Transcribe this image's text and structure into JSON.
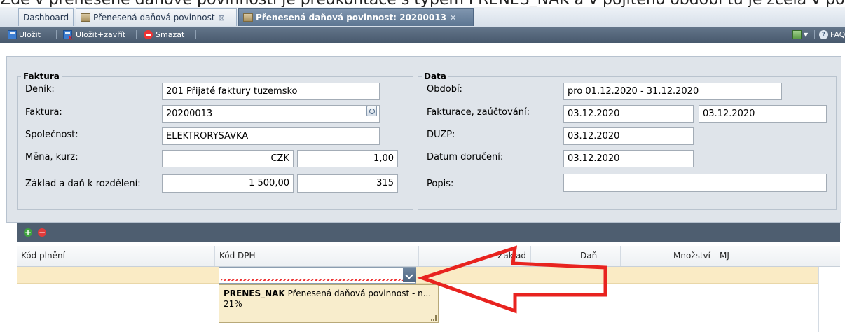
{
  "top_caption": "Zde v přenesené daňové povinnosti je předkontace s typem PRENES_NAK a v pojíteno období tu je zcela v pořádku",
  "tabs": [
    {
      "label": "Dashboard"
    },
    {
      "label": "Přenesená daňová povinnost"
    },
    {
      "label": "Přenesená daňová povinnost: 20200013"
    }
  ],
  "toolbar": {
    "save_label": "Uložit",
    "save_close_label": "Uložit+zavřít",
    "delete_label": "Smazat",
    "faq_label": "FAQ"
  },
  "faktura": {
    "legend": "Faktura",
    "denik_label": "Deník:",
    "denik_value": "201 Přijaté faktury tuzemsko",
    "faktura_label": "Faktura:",
    "faktura_value": "20200013",
    "spolecnost_label": "Společnost:",
    "spolecnost_value": "ELEKTRORYSAVKA",
    "mena_label": "Měna, kurz:",
    "mena_value": "CZK",
    "kurz_value": "1,00",
    "zaklad_label": "Základ a daň k rozdělení:",
    "zaklad_value": "1 500,00",
    "dan_value": "315"
  },
  "data": {
    "legend": "Data",
    "obdobi_label": "Období:",
    "obdobi_value": "pro 01.12.2020 - 31.12.2020",
    "fakturace_label": "Fakturace, zaúčtování:",
    "fakturace_value": "03.12.2020",
    "zauctovani_value": "03.12.2020",
    "duzp_label": "DUZP:",
    "duzp_value": "03.12.2020",
    "doruceni_label": "Datum doručení:",
    "doruceni_value": "03.12.2020",
    "popis_label": "Popis:",
    "popis_value": ""
  },
  "grid": {
    "columns": [
      "Kód plnění",
      "Kód DPH",
      "Základ",
      "Daň",
      "Množství",
      "MJ"
    ],
    "dropdown_code": "PRENES_NAK",
    "dropdown_desc": "Přenesená daňová povinnost - n...",
    "dropdown_rate": "21%"
  },
  "colors": {
    "arrow": "#e8231f",
    "row_highlight": "#faebc5"
  }
}
